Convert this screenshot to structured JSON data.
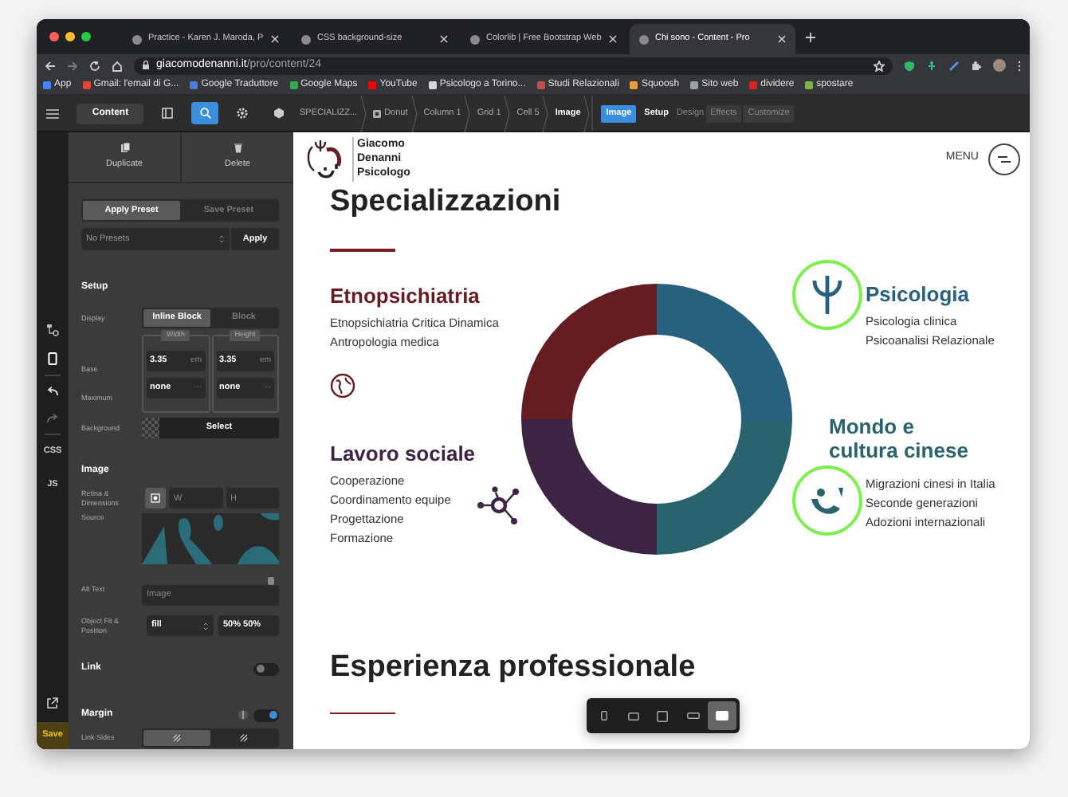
{
  "browser": {
    "tabs": [
      {
        "title": "Practice - Karen J. Maroda, P",
        "selected": false
      },
      {
        "title": "CSS background-size",
        "selected": false
      },
      {
        "title": "Colorlib | Free Bootstrap Web",
        "selected": false
      },
      {
        "title": "Chi sono - Content - Pro",
        "selected": true
      }
    ],
    "address": {
      "domain": "giacomodenanni.it",
      "path": "/pro/content/24"
    },
    "bookmarks": [
      {
        "label": "App",
        "color": "#4285f4"
      },
      {
        "label": "Gmail: l'email di G...",
        "color": "#ea4335"
      },
      {
        "label": "Google Traduttore",
        "color": "#4a7bd9"
      },
      {
        "label": "Google Maps",
        "color": "#34a853"
      },
      {
        "label": "YouTube",
        "color": "#ff0000"
      },
      {
        "label": "Psicologo a Torino...",
        "color": "#d8d8d8"
      },
      {
        "label": "Studi Relazionali",
        "color": "#c0504d"
      },
      {
        "label": "Squoosh",
        "color": "#f29c38"
      },
      {
        "label": "Sito web",
        "color": "#9aa0a6"
      },
      {
        "label": "dividere",
        "color": "#e02020"
      },
      {
        "label": "spostare",
        "color": "#7cb342"
      }
    ]
  },
  "toolbar": {
    "content_button": "Content",
    "tools": [
      {
        "kind": "panel",
        "selected": false
      },
      {
        "kind": "search",
        "selected": true
      },
      {
        "kind": "settings",
        "selected": false
      },
      {
        "kind": "cube",
        "selected": false
      }
    ],
    "breadcrumbs": [
      {
        "label": "SPECIALIZZ...",
        "kind": "plain"
      },
      {
        "label": "Donut",
        "kind": "component"
      },
      {
        "label": "Column 1",
        "kind": "plain"
      },
      {
        "label": "Grid 1",
        "kind": "plain"
      },
      {
        "label": "Cell 5",
        "kind": "plain"
      },
      {
        "label": "Image",
        "kind": "current"
      }
    ],
    "element_tag": "Image",
    "inspector_tabs": [
      {
        "label": "Setup",
        "selected": true,
        "kind": "plain"
      },
      {
        "label": "Design",
        "selected": false,
        "kind": "plain"
      },
      {
        "label": "Effects",
        "selected": false,
        "kind": "boxed"
      },
      {
        "label": "Customize",
        "selected": false,
        "kind": "boxed"
      }
    ]
  },
  "rail": {
    "css": "CSS",
    "js": "JS",
    "save": "Save"
  },
  "panel": {
    "actions": [
      "Duplicate",
      "Delete"
    ],
    "preset_tabs": [
      {
        "label": "Apply Preset",
        "selected": true
      },
      {
        "label": "Save Preset",
        "selected": false
      }
    ],
    "preset_select": "No Presets",
    "preset_apply": "Apply",
    "setup": {
      "title": "Setup",
      "display_label": "Display",
      "display_options": [
        {
          "label": "Inline Block",
          "selected": true
        },
        {
          "label": "Block",
          "selected": false
        }
      ],
      "size_headers": [
        "Width",
        "Height"
      ],
      "size_rows": [
        {
          "label": "Base",
          "fields": [
            {
              "value": "3.35",
              "unit": "em"
            },
            {
              "value": "3.35",
              "unit": "em"
            }
          ]
        },
        {
          "label": "Maximum",
          "fields": [
            {
              "value": "none",
              "unit": "···"
            },
            {
              "value": "none",
              "unit": "···"
            }
          ]
        }
      ],
      "background_label": "Background",
      "background_button": "Select"
    },
    "image": {
      "title": "Image",
      "retina_label": "Retina & Dimensions",
      "w_placeholder": "W",
      "h_placeholder": "H",
      "source_label": "Source",
      "alt_label": "Alt Text",
      "alt_placeholder": "Image",
      "fit_label": "Object Fit & Position",
      "fit_value": "fill",
      "position_value": "50% 50%"
    },
    "link": {
      "label": "Link",
      "on": false
    },
    "margin": {
      "label": "Margin",
      "on": true
    },
    "link_sides": {
      "label": "Link Sides",
      "options": [
        {
          "selected": true
        },
        {
          "selected": false
        }
      ]
    }
  },
  "page": {
    "logo": [
      "Giacomo",
      "Denanni",
      "Psicologo"
    ],
    "menu_label": "MENU",
    "heading": "Specializzazioni",
    "sections": [
      {
        "title": "Etnopsichiatria",
        "color": "#661d22",
        "highlighted": false,
        "items": [
          "Etnopsichiatria Critica Dinamica",
          "Antropologia medica"
        ]
      },
      {
        "title": "Psicologia",
        "color": "#27617d",
        "highlighted": true,
        "items": [
          "Psicologia clinica",
          "Psicoanalisi Relazionale"
        ]
      },
      {
        "title": "Lavoro sociale",
        "color": "#3e2444",
        "highlighted": false,
        "items": [
          "Cooperazione",
          "Coordinamento equipe",
          "Progettazione",
          "Formazione"
        ]
      },
      {
        "title": "Mondo e cultura cinese",
        "color": "#29636d",
        "highlighted": true,
        "items": [
          "Migrazioni cinesi in Italia",
          "Seconde generazioni",
          "Adozioni internazionali"
        ]
      }
    ],
    "next_heading": "Esperienza professionale"
  },
  "device_bar": [
    {
      "selected": false
    },
    {
      "selected": false
    },
    {
      "selected": false
    },
    {
      "selected": false
    },
    {
      "selected": true
    }
  ]
}
